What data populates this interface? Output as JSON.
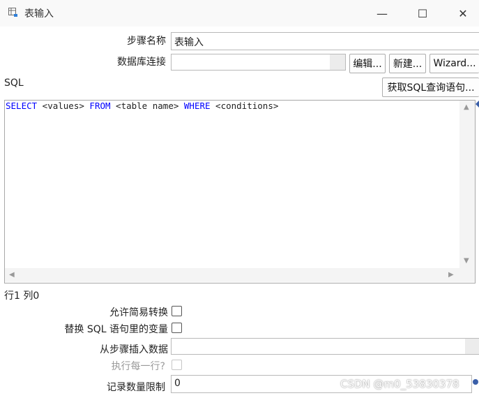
{
  "window": {
    "title": "表输入",
    "icon": "table-input-icon",
    "minimize_glyph": "—",
    "maximize_glyph": "☐",
    "close_glyph": "✕"
  },
  "form": {
    "step_name_label": "步骤名称",
    "step_name_value": "表输入",
    "db_connection_label": "数据库连接",
    "db_connection_value": "",
    "edit_button": "编辑...",
    "new_button": "新建...",
    "wizard_button": "Wizard...",
    "sql_label": "SQL",
    "get_sql_button": "获取SQL查询语句...",
    "sql_tokens": [
      {
        "text": "SELECT",
        "kw": true
      },
      {
        "text": " <values> ",
        "kw": false
      },
      {
        "text": "FROM",
        "kw": true
      },
      {
        "text": " <table name> ",
        "kw": false
      },
      {
        "text": "WHERE",
        "kw": true
      },
      {
        "text": " <conditions>",
        "kw": false
      }
    ],
    "cursor_position": "行1 列0",
    "allow_lazy_conversion_label": "允许简易转换",
    "allow_lazy_conversion_checked": false,
    "replace_variables_label": "替换 SQL 语句里的变量",
    "replace_variables_checked": false,
    "insert_data_from_step_label": "从步骤插入数据",
    "insert_data_from_step_value": "",
    "execute_each_row_label": "执行每一行?",
    "execute_each_row_checked": false,
    "limit_size_label": "记录数量限制",
    "limit_size_value": "0"
  },
  "watermark": "CSDN @m0_53830378",
  "colors": {
    "sql_keyword": "#0000ff",
    "background": "#ffffff"
  }
}
